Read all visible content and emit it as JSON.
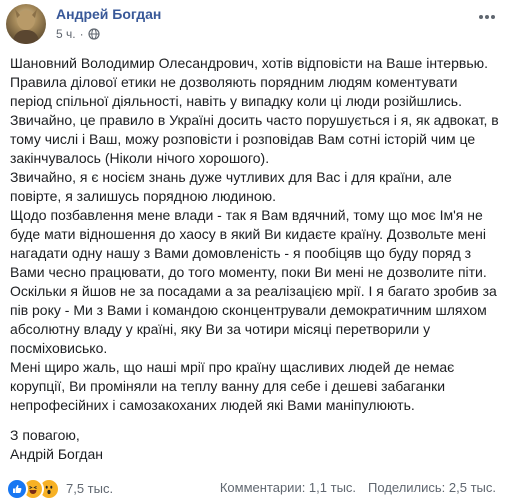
{
  "post": {
    "author": "Андрей Богдан",
    "time": "5 ч.",
    "separator": "·",
    "paragraphs": [
      "Шановний Володимир Олесандрович, хотів відповісти на Ваше інтервью. Правила ділової етики не дозволяють порядним людям коментувати період спільної діяльності, навіть у випадку коли ці люди розійшлись.",
      "Звичайно, це правило в Україні досить часто порушується і я, як адвокат, в тому числі і Ваш, можу розповісти і розповідав Вам сотні історій чим це закінчувалось (Ніколи нічого хорошого).",
      "Звичайно, я є носієм знань дуже чутливих для Вас і для країни, але повірте, я залишусь порядною людиною.",
      "Щодо позбавлення мене влади - так я Вам вдячний, тому що моє Ім'я не буде мати відношення до хаосу в який Ви кидаєте країну. Дозвольте мені нагадати одну нашу з Вами домовленість - я пообіцяв що буду поряд з Вами чесно працювати, до того моменту, поки Ви мені не дозволите піти.",
      "Оскільки я йшов не за посадами а за реалізацією мрії. І я багато зробив за пів року - Ми з Вами і командою сконцентрували демократичним шляхом абсолютну владу у країні, яку Ви за чотири місяці перетворили у посміховисько.",
      "Мені щиро жаль, що наші мрії про країну щасливих людей де немає корупції, Ви проміняли на теплу ванну для себе і дешеві забаганки непрофесійних і самозакоханих людей які Вами маніпулюють."
    ],
    "signature_lines": [
      "З повагою,",
      "Андрій Богдан"
    ]
  },
  "footer": {
    "reactions_count": "7,5 тыс.",
    "comments": "Комментарии: 1,1 тыс.",
    "shares": "Поделились: 2,5 тыс."
  },
  "icons": {
    "globe": "globe-icon",
    "options": "more-options-icon",
    "like": "like-reaction-icon",
    "haha": "haha-reaction-icon",
    "wow": "wow-reaction-icon"
  },
  "colors": {
    "author": "#385898",
    "meta": "#606770",
    "text": "#1c1e21",
    "like": "#1877f2",
    "emoji": "#f7b125"
  }
}
